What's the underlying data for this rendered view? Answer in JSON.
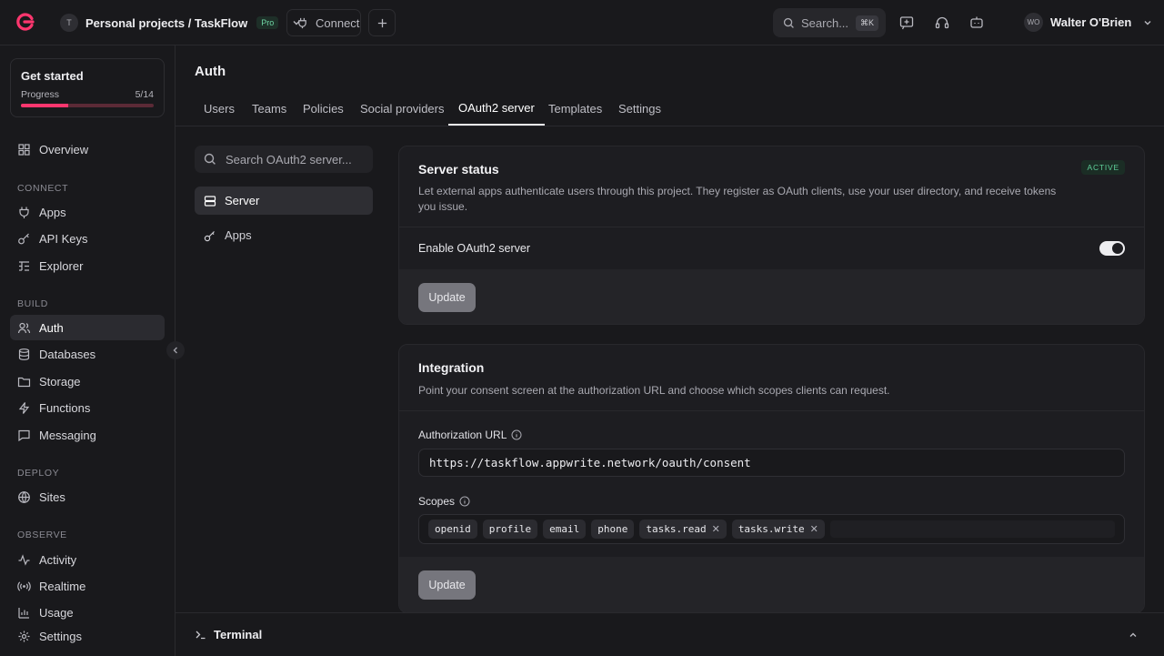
{
  "header": {
    "project_initial": "T",
    "project_path": "Personal projects / TaskFlow",
    "plan_badge": "Pro",
    "connect_label": "Connect",
    "search_placeholder": "Search...",
    "search_shortcut": "⌘K",
    "user_initials": "WO",
    "user_name": "Walter O'Brien"
  },
  "colors": {
    "brand": "#fd366e",
    "active_badge": "#5fd09a"
  },
  "sidebar": {
    "get_started": {
      "title": "Get started",
      "progress_label": "Progress",
      "progress_text": "5/14",
      "progress_value": 0.357
    },
    "overview": "Overview",
    "sections": {
      "connect": "CONNECT",
      "build": "BUILD",
      "deploy": "DEPLOY",
      "observe": "OBSERVE"
    },
    "items": {
      "apps": "Apps",
      "api_keys": "API Keys",
      "explorer": "Explorer",
      "auth": "Auth",
      "databases": "Databases",
      "storage": "Storage",
      "functions": "Functions",
      "messaging": "Messaging",
      "sites": "Sites",
      "activity": "Activity",
      "realtime": "Realtime",
      "usage": "Usage",
      "settings": "Settings"
    }
  },
  "main": {
    "title": "Auth",
    "tabs": [
      "Users",
      "Teams",
      "Policies",
      "Social providers",
      "OAuth2 server",
      "Templates",
      "Settings"
    ],
    "active_tab": "OAuth2 server",
    "subnav": {
      "search_placeholder": "Search OAuth2 server...",
      "items": [
        "Server",
        "Apps"
      ]
    },
    "server_status": {
      "title": "Server status",
      "badge": "ACTIVE",
      "description": "Let external apps authenticate users through this project. They register as OAuth clients, use your user directory, and receive tokens you issue.",
      "toggle_label": "Enable OAuth2 server",
      "toggle_on": true,
      "update_label": "Update"
    },
    "integration": {
      "title": "Integration",
      "description": "Point your consent screen at the authorization URL and choose which scopes clients can request.",
      "auth_url_label": "Authorization URL",
      "auth_url": "https://taskflow.appwrite.network/oauth/consent",
      "scopes_label": "Scopes",
      "fixed_scopes": [
        "openid",
        "profile",
        "email",
        "phone"
      ],
      "custom_scopes": [
        "tasks.read",
        "tasks.write"
      ],
      "update_label": "Update"
    }
  },
  "terminal": {
    "label": "Terminal"
  }
}
